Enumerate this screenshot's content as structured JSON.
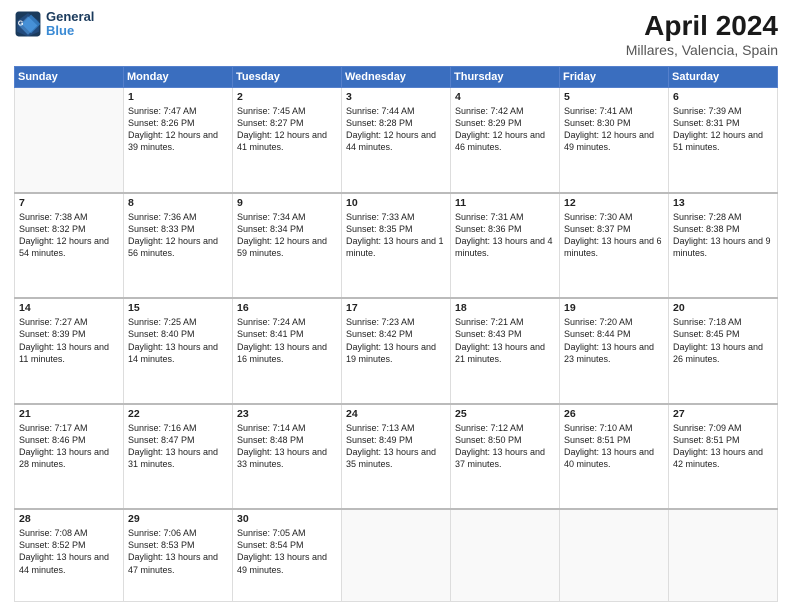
{
  "header": {
    "logo_line1": "General",
    "logo_line2": "Blue",
    "title": "April 2024",
    "subtitle": "Millares, Valencia, Spain"
  },
  "weekdays": [
    "Sunday",
    "Monday",
    "Tuesday",
    "Wednesday",
    "Thursday",
    "Friday",
    "Saturday"
  ],
  "weeks": [
    [
      {
        "day": "",
        "sunrise": "",
        "sunset": "",
        "daylight": ""
      },
      {
        "day": "1",
        "sunrise": "Sunrise: 7:47 AM",
        "sunset": "Sunset: 8:26 PM",
        "daylight": "Daylight: 12 hours and 39 minutes."
      },
      {
        "day": "2",
        "sunrise": "Sunrise: 7:45 AM",
        "sunset": "Sunset: 8:27 PM",
        "daylight": "Daylight: 12 hours and 41 minutes."
      },
      {
        "day": "3",
        "sunrise": "Sunrise: 7:44 AM",
        "sunset": "Sunset: 8:28 PM",
        "daylight": "Daylight: 12 hours and 44 minutes."
      },
      {
        "day": "4",
        "sunrise": "Sunrise: 7:42 AM",
        "sunset": "Sunset: 8:29 PM",
        "daylight": "Daylight: 12 hours and 46 minutes."
      },
      {
        "day": "5",
        "sunrise": "Sunrise: 7:41 AM",
        "sunset": "Sunset: 8:30 PM",
        "daylight": "Daylight: 12 hours and 49 minutes."
      },
      {
        "day": "6",
        "sunrise": "Sunrise: 7:39 AM",
        "sunset": "Sunset: 8:31 PM",
        "daylight": "Daylight: 12 hours and 51 minutes."
      }
    ],
    [
      {
        "day": "7",
        "sunrise": "Sunrise: 7:38 AM",
        "sunset": "Sunset: 8:32 PM",
        "daylight": "Daylight: 12 hours and 54 minutes."
      },
      {
        "day": "8",
        "sunrise": "Sunrise: 7:36 AM",
        "sunset": "Sunset: 8:33 PM",
        "daylight": "Daylight: 12 hours and 56 minutes."
      },
      {
        "day": "9",
        "sunrise": "Sunrise: 7:34 AM",
        "sunset": "Sunset: 8:34 PM",
        "daylight": "Daylight: 12 hours and 59 minutes."
      },
      {
        "day": "10",
        "sunrise": "Sunrise: 7:33 AM",
        "sunset": "Sunset: 8:35 PM",
        "daylight": "Daylight: 13 hours and 1 minute."
      },
      {
        "day": "11",
        "sunrise": "Sunrise: 7:31 AM",
        "sunset": "Sunset: 8:36 PM",
        "daylight": "Daylight: 13 hours and 4 minutes."
      },
      {
        "day": "12",
        "sunrise": "Sunrise: 7:30 AM",
        "sunset": "Sunset: 8:37 PM",
        "daylight": "Daylight: 13 hours and 6 minutes."
      },
      {
        "day": "13",
        "sunrise": "Sunrise: 7:28 AM",
        "sunset": "Sunset: 8:38 PM",
        "daylight": "Daylight: 13 hours and 9 minutes."
      }
    ],
    [
      {
        "day": "14",
        "sunrise": "Sunrise: 7:27 AM",
        "sunset": "Sunset: 8:39 PM",
        "daylight": "Daylight: 13 hours and 11 minutes."
      },
      {
        "day": "15",
        "sunrise": "Sunrise: 7:25 AM",
        "sunset": "Sunset: 8:40 PM",
        "daylight": "Daylight: 13 hours and 14 minutes."
      },
      {
        "day": "16",
        "sunrise": "Sunrise: 7:24 AM",
        "sunset": "Sunset: 8:41 PM",
        "daylight": "Daylight: 13 hours and 16 minutes."
      },
      {
        "day": "17",
        "sunrise": "Sunrise: 7:23 AM",
        "sunset": "Sunset: 8:42 PM",
        "daylight": "Daylight: 13 hours and 19 minutes."
      },
      {
        "day": "18",
        "sunrise": "Sunrise: 7:21 AM",
        "sunset": "Sunset: 8:43 PM",
        "daylight": "Daylight: 13 hours and 21 minutes."
      },
      {
        "day": "19",
        "sunrise": "Sunrise: 7:20 AM",
        "sunset": "Sunset: 8:44 PM",
        "daylight": "Daylight: 13 hours and 23 minutes."
      },
      {
        "day": "20",
        "sunrise": "Sunrise: 7:18 AM",
        "sunset": "Sunset: 8:45 PM",
        "daylight": "Daylight: 13 hours and 26 minutes."
      }
    ],
    [
      {
        "day": "21",
        "sunrise": "Sunrise: 7:17 AM",
        "sunset": "Sunset: 8:46 PM",
        "daylight": "Daylight: 13 hours and 28 minutes."
      },
      {
        "day": "22",
        "sunrise": "Sunrise: 7:16 AM",
        "sunset": "Sunset: 8:47 PM",
        "daylight": "Daylight: 13 hours and 31 minutes."
      },
      {
        "day": "23",
        "sunrise": "Sunrise: 7:14 AM",
        "sunset": "Sunset: 8:48 PM",
        "daylight": "Daylight: 13 hours and 33 minutes."
      },
      {
        "day": "24",
        "sunrise": "Sunrise: 7:13 AM",
        "sunset": "Sunset: 8:49 PM",
        "daylight": "Daylight: 13 hours and 35 minutes."
      },
      {
        "day": "25",
        "sunrise": "Sunrise: 7:12 AM",
        "sunset": "Sunset: 8:50 PM",
        "daylight": "Daylight: 13 hours and 37 minutes."
      },
      {
        "day": "26",
        "sunrise": "Sunrise: 7:10 AM",
        "sunset": "Sunset: 8:51 PM",
        "daylight": "Daylight: 13 hours and 40 minutes."
      },
      {
        "day": "27",
        "sunrise": "Sunrise: 7:09 AM",
        "sunset": "Sunset: 8:51 PM",
        "daylight": "Daylight: 13 hours and 42 minutes."
      }
    ],
    [
      {
        "day": "28",
        "sunrise": "Sunrise: 7:08 AM",
        "sunset": "Sunset: 8:52 PM",
        "daylight": "Daylight: 13 hours and 44 minutes."
      },
      {
        "day": "29",
        "sunrise": "Sunrise: 7:06 AM",
        "sunset": "Sunset: 8:53 PM",
        "daylight": "Daylight: 13 hours and 47 minutes."
      },
      {
        "day": "30",
        "sunrise": "Sunrise: 7:05 AM",
        "sunset": "Sunset: 8:54 PM",
        "daylight": "Daylight: 13 hours and 49 minutes."
      },
      {
        "day": "",
        "sunrise": "",
        "sunset": "",
        "daylight": ""
      },
      {
        "day": "",
        "sunrise": "",
        "sunset": "",
        "daylight": ""
      },
      {
        "day": "",
        "sunrise": "",
        "sunset": "",
        "daylight": ""
      },
      {
        "day": "",
        "sunrise": "",
        "sunset": "",
        "daylight": ""
      }
    ]
  ]
}
